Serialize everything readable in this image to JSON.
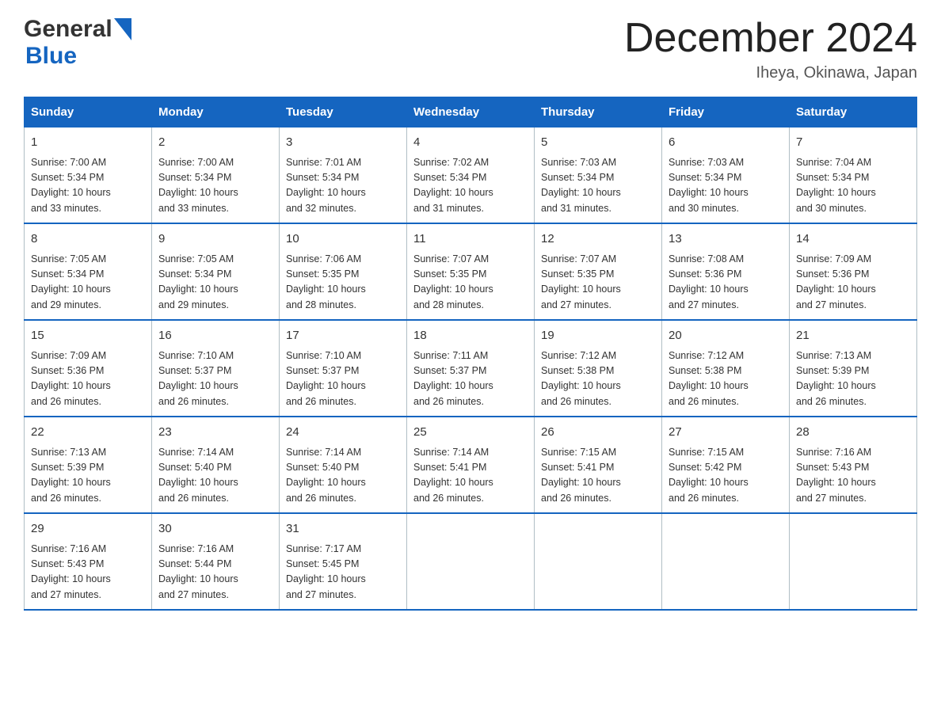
{
  "logo": {
    "general": "General",
    "blue": "Blue"
  },
  "title": "December 2024",
  "subtitle": "Iheya, Okinawa, Japan",
  "days_of_week": [
    "Sunday",
    "Monday",
    "Tuesday",
    "Wednesday",
    "Thursday",
    "Friday",
    "Saturday"
  ],
  "weeks": [
    [
      {
        "day": "1",
        "sunrise": "7:00 AM",
        "sunset": "5:34 PM",
        "daylight": "10 hours and 33 minutes."
      },
      {
        "day": "2",
        "sunrise": "7:00 AM",
        "sunset": "5:34 PM",
        "daylight": "10 hours and 33 minutes."
      },
      {
        "day": "3",
        "sunrise": "7:01 AM",
        "sunset": "5:34 PM",
        "daylight": "10 hours and 32 minutes."
      },
      {
        "day": "4",
        "sunrise": "7:02 AM",
        "sunset": "5:34 PM",
        "daylight": "10 hours and 31 minutes."
      },
      {
        "day": "5",
        "sunrise": "7:03 AM",
        "sunset": "5:34 PM",
        "daylight": "10 hours and 31 minutes."
      },
      {
        "day": "6",
        "sunrise": "7:03 AM",
        "sunset": "5:34 PM",
        "daylight": "10 hours and 30 minutes."
      },
      {
        "day": "7",
        "sunrise": "7:04 AM",
        "sunset": "5:34 PM",
        "daylight": "10 hours and 30 minutes."
      }
    ],
    [
      {
        "day": "8",
        "sunrise": "7:05 AM",
        "sunset": "5:34 PM",
        "daylight": "10 hours and 29 minutes."
      },
      {
        "day": "9",
        "sunrise": "7:05 AM",
        "sunset": "5:34 PM",
        "daylight": "10 hours and 29 minutes."
      },
      {
        "day": "10",
        "sunrise": "7:06 AM",
        "sunset": "5:35 PM",
        "daylight": "10 hours and 28 minutes."
      },
      {
        "day": "11",
        "sunrise": "7:07 AM",
        "sunset": "5:35 PM",
        "daylight": "10 hours and 28 minutes."
      },
      {
        "day": "12",
        "sunrise": "7:07 AM",
        "sunset": "5:35 PM",
        "daylight": "10 hours and 27 minutes."
      },
      {
        "day": "13",
        "sunrise": "7:08 AM",
        "sunset": "5:36 PM",
        "daylight": "10 hours and 27 minutes."
      },
      {
        "day": "14",
        "sunrise": "7:09 AM",
        "sunset": "5:36 PM",
        "daylight": "10 hours and 27 minutes."
      }
    ],
    [
      {
        "day": "15",
        "sunrise": "7:09 AM",
        "sunset": "5:36 PM",
        "daylight": "10 hours and 26 minutes."
      },
      {
        "day": "16",
        "sunrise": "7:10 AM",
        "sunset": "5:37 PM",
        "daylight": "10 hours and 26 minutes."
      },
      {
        "day": "17",
        "sunrise": "7:10 AM",
        "sunset": "5:37 PM",
        "daylight": "10 hours and 26 minutes."
      },
      {
        "day": "18",
        "sunrise": "7:11 AM",
        "sunset": "5:37 PM",
        "daylight": "10 hours and 26 minutes."
      },
      {
        "day": "19",
        "sunrise": "7:12 AM",
        "sunset": "5:38 PM",
        "daylight": "10 hours and 26 minutes."
      },
      {
        "day": "20",
        "sunrise": "7:12 AM",
        "sunset": "5:38 PM",
        "daylight": "10 hours and 26 minutes."
      },
      {
        "day": "21",
        "sunrise": "7:13 AM",
        "sunset": "5:39 PM",
        "daylight": "10 hours and 26 minutes."
      }
    ],
    [
      {
        "day": "22",
        "sunrise": "7:13 AM",
        "sunset": "5:39 PM",
        "daylight": "10 hours and 26 minutes."
      },
      {
        "day": "23",
        "sunrise": "7:14 AM",
        "sunset": "5:40 PM",
        "daylight": "10 hours and 26 minutes."
      },
      {
        "day": "24",
        "sunrise": "7:14 AM",
        "sunset": "5:40 PM",
        "daylight": "10 hours and 26 minutes."
      },
      {
        "day": "25",
        "sunrise": "7:14 AM",
        "sunset": "5:41 PM",
        "daylight": "10 hours and 26 minutes."
      },
      {
        "day": "26",
        "sunrise": "7:15 AM",
        "sunset": "5:41 PM",
        "daylight": "10 hours and 26 minutes."
      },
      {
        "day": "27",
        "sunrise": "7:15 AM",
        "sunset": "5:42 PM",
        "daylight": "10 hours and 26 minutes."
      },
      {
        "day": "28",
        "sunrise": "7:16 AM",
        "sunset": "5:43 PM",
        "daylight": "10 hours and 27 minutes."
      }
    ],
    [
      {
        "day": "29",
        "sunrise": "7:16 AM",
        "sunset": "5:43 PM",
        "daylight": "10 hours and 27 minutes."
      },
      {
        "day": "30",
        "sunrise": "7:16 AM",
        "sunset": "5:44 PM",
        "daylight": "10 hours and 27 minutes."
      },
      {
        "day": "31",
        "sunrise": "7:17 AM",
        "sunset": "5:45 PM",
        "daylight": "10 hours and 27 minutes."
      },
      null,
      null,
      null,
      null
    ]
  ],
  "sunrise_label": "Sunrise:",
  "sunset_label": "Sunset:",
  "daylight_label": "Daylight:"
}
